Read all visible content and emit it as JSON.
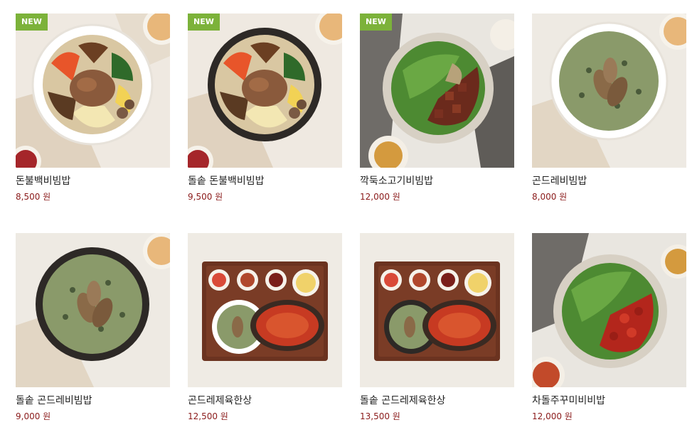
{
  "products": [
    {
      "name": "돈불백비빔밥",
      "price": "8,500 원",
      "badge": "NEW",
      "image": "bowl-white-bulgogi-bibimbap"
    },
    {
      "name": "돌솥 돈불백비빔밥",
      "price": "9,500 원",
      "badge": "NEW",
      "image": "stonepot-bulgogi-bibimbap"
    },
    {
      "name": "깍둑소고기비빔밥",
      "price": "12,000 원",
      "badge": "NEW",
      "image": "bowl-greens-cubed-beef"
    },
    {
      "name": "곤드레비빔밥",
      "price": "8,000 원",
      "badge": "",
      "image": "bowl-white-gondre-rice"
    },
    {
      "name": "돌솥 곤드레비빔밥",
      "price": "9,000 원",
      "badge": "",
      "image": "stonepot-gondre-rice"
    },
    {
      "name": "곤드레제육한상",
      "price": "12,500 원",
      "badge": "",
      "image": "tray-gondre-jeyuk-set"
    },
    {
      "name": "돌솥 곤드레제육한상",
      "price": "13,500 원",
      "badge": "",
      "image": "tray-stonepot-gondre-jeyuk-set"
    },
    {
      "name": "차돌주꾸미비비밥",
      "price": "12,000 원",
      "badge": "",
      "image": "bowl-greens-spicy-jjukkumi"
    }
  ],
  "colors": {
    "badge": "#7cb23a",
    "price": "#8a1a1a",
    "name": "#222222"
  }
}
